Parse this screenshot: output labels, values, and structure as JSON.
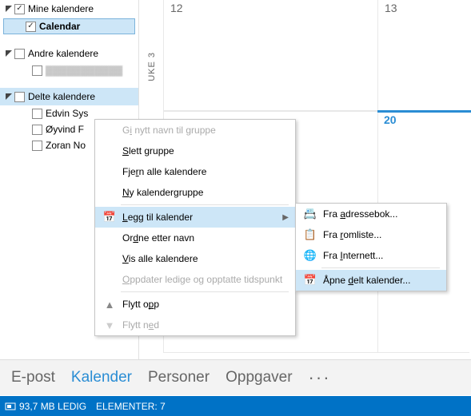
{
  "sidebar": {
    "groups": [
      {
        "label": "Mine kalendere",
        "checked": true,
        "items": [
          {
            "label": "Calendar",
            "checked": true,
            "selected": true
          }
        ]
      },
      {
        "label": "Andre kalendere",
        "checked": false,
        "items": [
          {
            "label": "(skjult kalender)",
            "checked": false,
            "disabled": true
          }
        ]
      },
      {
        "label": "Delte kalendere",
        "checked": false,
        "highlight": true,
        "items": [
          {
            "label": "Edvin Sys",
            "checked": false
          },
          {
            "label": "Øyvind F",
            "checked": false
          },
          {
            "label": "Zoran No",
            "checked": false
          }
        ]
      }
    ]
  },
  "calendar": {
    "week_label": "UKE 3",
    "days": [
      {
        "num": "12"
      },
      {
        "num": "13"
      },
      {
        "num_highlight": "20"
      }
    ]
  },
  "context_menu_1": {
    "items": [
      {
        "label_pre": "G",
        "label_u": "i",
        "label_post": " nytt navn til gruppe",
        "disabled": true
      },
      {
        "label_pre": "",
        "label_u": "S",
        "label_post": "lett gruppe"
      },
      {
        "label_pre": "Fje",
        "label_u": "r",
        "label_post": "n alle kalendere"
      },
      {
        "label_pre": "",
        "label_u": "N",
        "label_post": "y kalendergruppe"
      },
      {
        "sep": true
      },
      {
        "label_pre": "",
        "label_u": "L",
        "label_post": "egg til kalender",
        "icon": "calendar-add",
        "submenu": true,
        "highlight": true
      },
      {
        "label_pre": "Or",
        "label_u": "d",
        "label_post": "ne etter navn"
      },
      {
        "label_pre": "",
        "label_u": "V",
        "label_post": "is alle kalendere"
      },
      {
        "label_pre": "",
        "label_u": "O",
        "label_post": "ppdater ledige og opptatte tidspunkt",
        "disabled": true
      },
      {
        "sep": true
      },
      {
        "label_pre": "Flytt o",
        "label_u": "p",
        "label_post": "p",
        "icon": "up"
      },
      {
        "label_pre": "Flytt n",
        "label_u": "e",
        "label_post": "d",
        "icon": "down",
        "disabled": true
      }
    ]
  },
  "context_menu_2": {
    "items": [
      {
        "label_pre": "Fra ",
        "label_u": "a",
        "label_post": "dressebok...",
        "icon": "address-book"
      },
      {
        "label_pre": "Fra ",
        "label_u": "r",
        "label_post": "omliste...",
        "icon": "roomlist"
      },
      {
        "label_pre": "Fra ",
        "label_u": "I",
        "label_post": "nternett...",
        "icon": "internet"
      },
      {
        "sep": true
      },
      {
        "label_pre": "Åpne ",
        "label_u": "d",
        "label_post": "elt kalender...",
        "icon": "shared-cal",
        "highlight": true
      }
    ]
  },
  "nav": {
    "items": [
      {
        "label": "E-post"
      },
      {
        "label": "Kalender",
        "active": true
      },
      {
        "label": "Personer"
      },
      {
        "label": "Oppgaver"
      }
    ],
    "more": "···"
  },
  "status": {
    "free": "93,7 MB LEDIG",
    "items": "ELEMENTER: 7"
  }
}
